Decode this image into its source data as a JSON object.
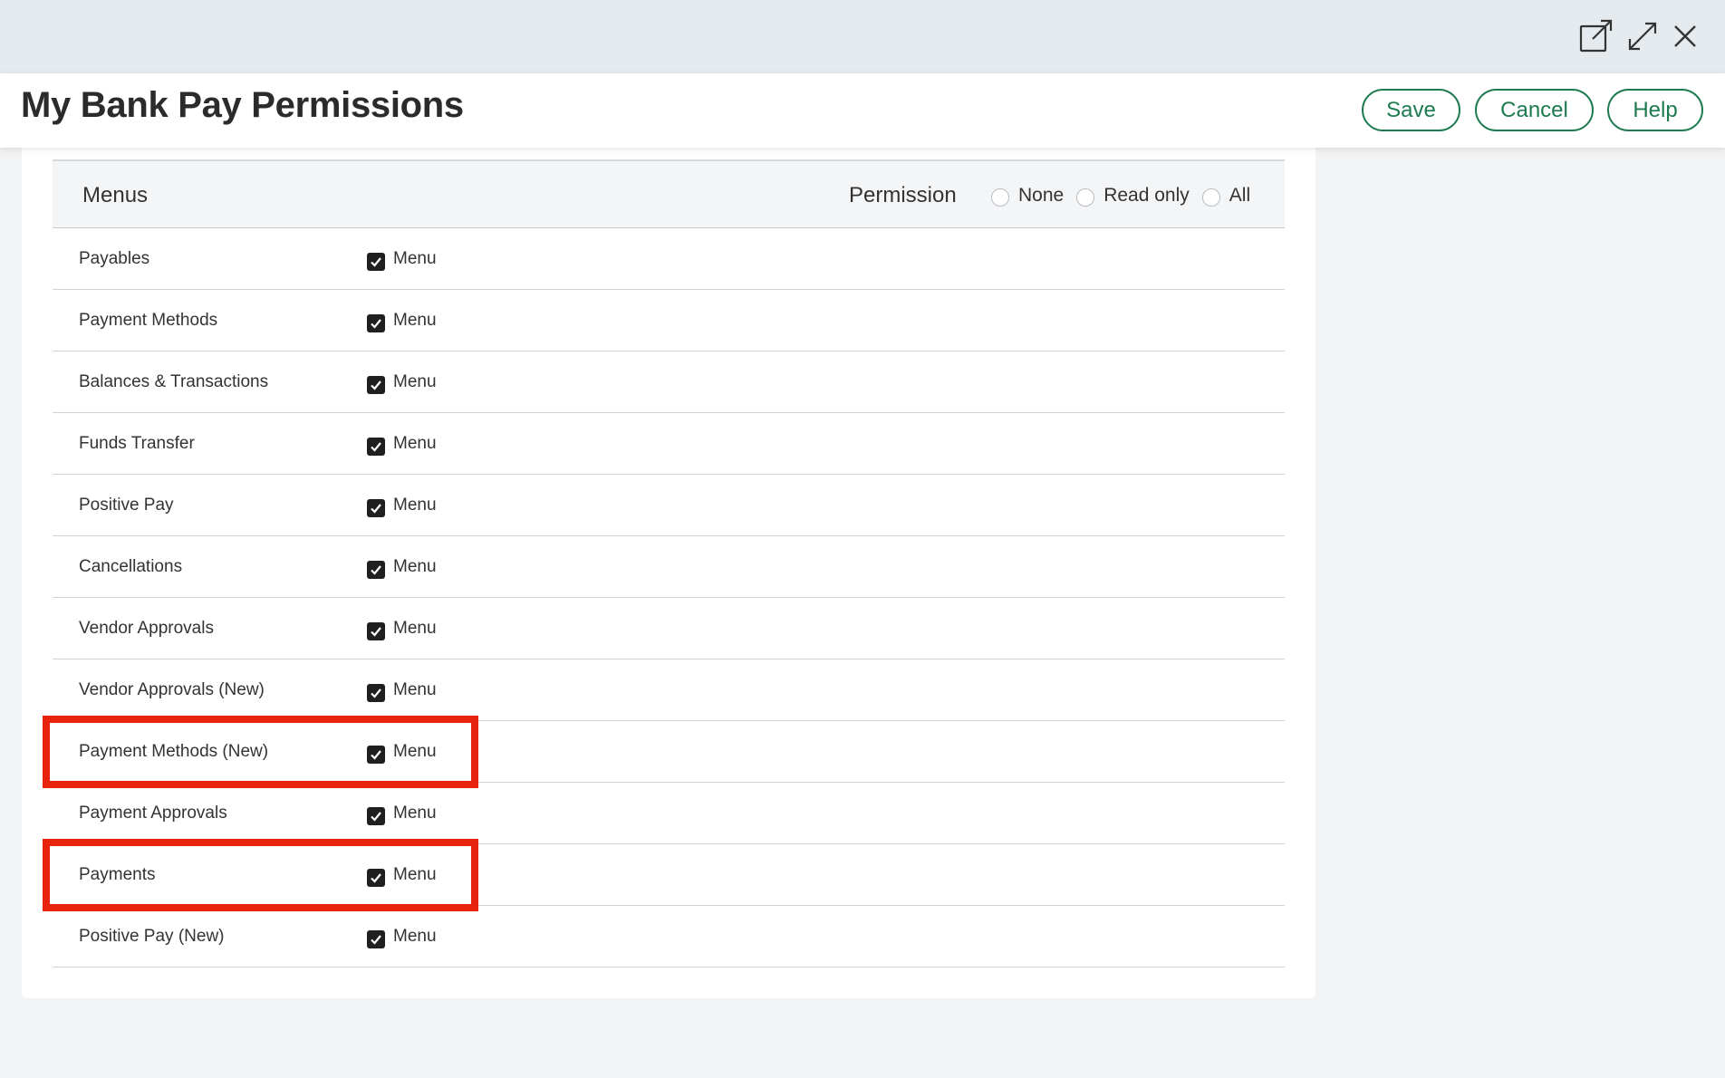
{
  "window": {
    "icons": [
      "open-in-new-window-icon",
      "expand-icon",
      "close-icon"
    ]
  },
  "header": {
    "title": "My Bank Pay Permissions",
    "save_label": "Save",
    "cancel_label": "Cancel",
    "help_label": "Help",
    "accent_color": "#1e7a4f"
  },
  "table": {
    "col_menus": "Menus",
    "col_permission": "Permission",
    "permission_options": [
      "None",
      "Read only",
      "All"
    ],
    "rows": [
      {
        "name": "Payables",
        "checkbox_label": "Menu",
        "checked": true
      },
      {
        "name": "Payment Methods",
        "checkbox_label": "Menu",
        "checked": true
      },
      {
        "name": "Balances & Transactions",
        "checkbox_label": "Menu",
        "checked": true
      },
      {
        "name": "Funds Transfer",
        "checkbox_label": "Menu",
        "checked": true
      },
      {
        "name": "Positive Pay",
        "checkbox_label": "Menu",
        "checked": true
      },
      {
        "name": "Cancellations",
        "checkbox_label": "Menu",
        "checked": true
      },
      {
        "name": "Vendor Approvals",
        "checkbox_label": "Menu",
        "checked": true
      },
      {
        "name": "Vendor Approvals (New)",
        "checkbox_label": "Menu",
        "checked": true
      },
      {
        "name": "Payment Methods (New)",
        "checkbox_label": "Menu",
        "checked": true
      },
      {
        "name": "Payment Approvals",
        "checkbox_label": "Menu",
        "checked": true
      },
      {
        "name": "Payments",
        "checkbox_label": "Menu",
        "checked": true
      },
      {
        "name": "Positive Pay (New)",
        "checkbox_label": "Menu",
        "checked": true
      }
    ]
  },
  "annotations": {
    "highlight_color": "#e8230e",
    "highlighted_rows": [
      "Payment Methods (New)",
      "Payments"
    ]
  }
}
